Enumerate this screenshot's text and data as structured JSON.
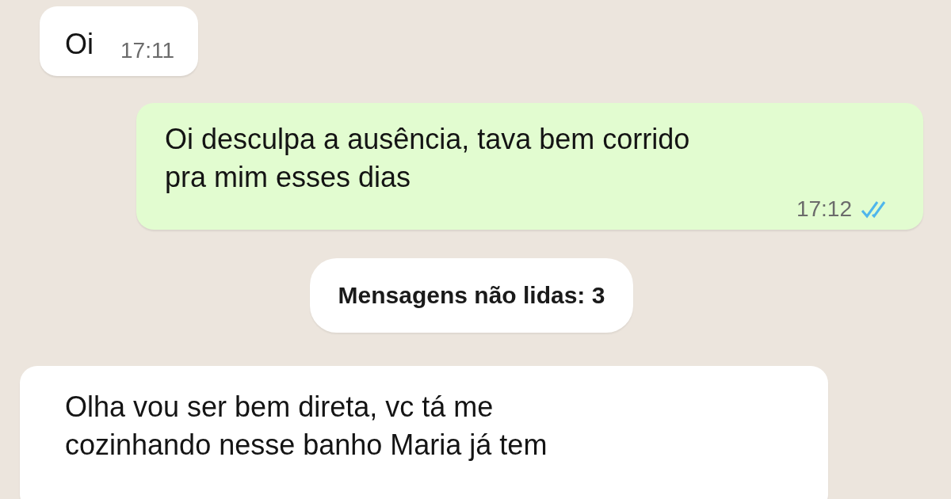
{
  "messages": [
    {
      "kind": "incoming",
      "text": "Oi",
      "time": "17:11"
    },
    {
      "kind": "outgoing",
      "text": "Oi desculpa a ausência, tava bem corrido\npra mim esses dias",
      "time": "17:12",
      "read": true
    },
    {
      "kind": "divider",
      "text": "Mensagens não lidas: 3"
    },
    {
      "kind": "incoming",
      "text": "Olha vou ser bem direta, vc tá me\ncozinhando nesse banho Maria já tem"
    }
  ]
}
